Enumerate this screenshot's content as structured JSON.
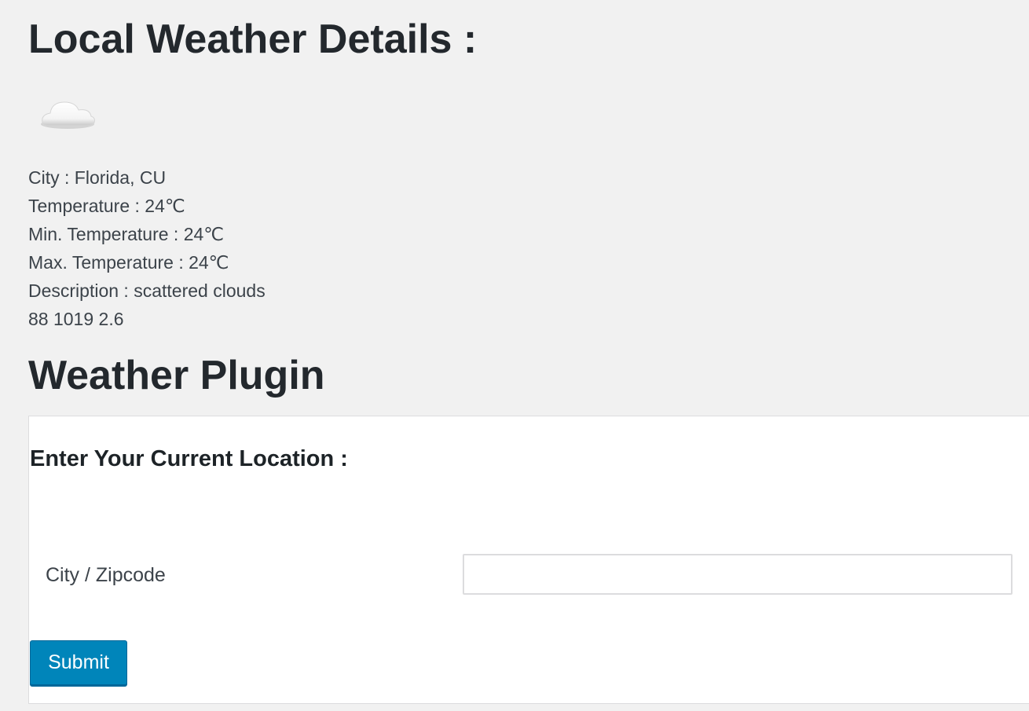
{
  "page": {
    "title": "Local Weather Details :"
  },
  "weather": {
    "icon": "cloud-icon",
    "city": "City : Florida, CU",
    "temperature": "Temperature : 24℃",
    "min_temperature": "Min. Temperature : 24℃",
    "max_temperature": "Max. Temperature : 24℃",
    "description": "Description : scattered clouds",
    "extra": "88 1019 2.6"
  },
  "plugin": {
    "title": "Weather Plugin",
    "form_heading": "Enter Your Current Location :",
    "field_label": "City / Zipcode",
    "field_value": "",
    "field_placeholder": "",
    "submit_label": "Submit"
  },
  "colors": {
    "background": "#f1f1f1",
    "panel": "#ffffff",
    "button": "#0085ba"
  }
}
